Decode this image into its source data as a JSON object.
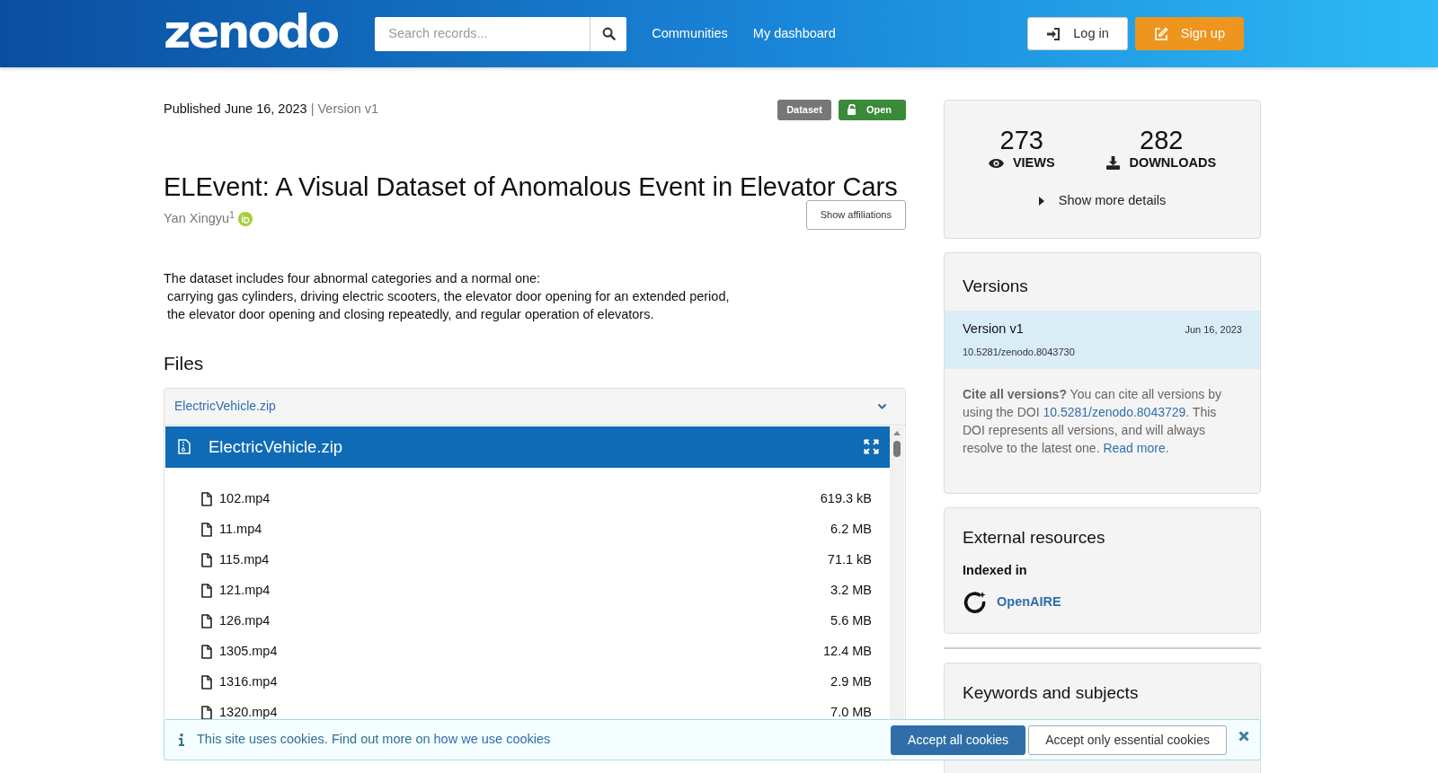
{
  "header": {
    "logo": "zenodo",
    "search": {
      "placeholder": "Search records..."
    },
    "nav_links": [
      "Communities",
      "My dashboard"
    ],
    "buttons": [
      {
        "label": "Log in",
        "kind": "login"
      },
      {
        "label": "Sign up",
        "kind": "signup"
      }
    ]
  },
  "record": {
    "published": "Published June 16, 2023",
    "version": "| Version v1",
    "badges": [
      {
        "label": "Dataset",
        "kind": "type"
      },
      {
        "label": "Open",
        "kind": "access"
      }
    ],
    "title": "ELEvent: A Visual Dataset of Anomalous Event in Elevator Cars",
    "creators": [
      {
        "name": "Yan Xingyu",
        "affiliation_mark": "1",
        "orcid": true
      }
    ],
    "affiliations_button": "Show affiliations",
    "description": [
      "The dataset includes four abnormal categories and a normal one:",
      " carrying gas cylinders, driving electric scooters, the elevator door opening for an extended period,",
      " the elevator door opening and closing repeatedly, and regular operation of elevators."
    ]
  },
  "files": {
    "heading": "Files",
    "accordion_title": "ElectricVehicle.zip",
    "expanded": true,
    "preview_title": "ElectricVehicle.zip",
    "entries": [
      {
        "name": "102.mp4",
        "size": "619.3 kB"
      },
      {
        "name": "11.mp4",
        "size": "6.2 MB"
      },
      {
        "name": "115.mp4",
        "size": "71.1 kB"
      },
      {
        "name": "121.mp4",
        "size": "3.2 MB"
      },
      {
        "name": "126.mp4",
        "size": "5.6 MB"
      },
      {
        "name": "1305.mp4",
        "size": "12.4 MB"
      },
      {
        "name": "1316.mp4",
        "size": "2.9 MB"
      },
      {
        "name": "1320.mp4",
        "size": "7.0 MB"
      }
    ]
  },
  "sidebar": {
    "stats": [
      {
        "value": "273",
        "label": "VIEWS",
        "kind": "views"
      },
      {
        "value": "282",
        "label": "DOWNLOADS",
        "kind": "downloads"
      }
    ],
    "more_details": "Show more details",
    "versions": {
      "heading": "Versions",
      "items": [
        {
          "label": "Version v1",
          "date": "Jun 16, 2023",
          "doi": "10.5281/zenodo.8043730",
          "selected": true
        }
      ],
      "cite": [
        {
          "kind": "text",
          "text": "**Cite all versions?** You can cite all versions by using the DOI "
        },
        {
          "kind": "link",
          "text": "10.5281/zenodo.8043729"
        },
        {
          "kind": "text",
          "text": ". This DOI represents all versions, and will always resolve to the latest one. "
        },
        {
          "kind": "link",
          "text": "Read more"
        },
        {
          "kind": "text",
          "text": "."
        }
      ]
    },
    "external": {
      "heading": "External resources",
      "subheading": "Indexed in",
      "items": [
        "OpenAIRE"
      ]
    },
    "keywords": {
      "heading": "Keywords and subjects"
    }
  },
  "cookie_banner": {
    "text": "This site uses cookies. Find out more on ",
    "link": "how we use cookies",
    "buttons": [
      {
        "label": "Accept all cookies",
        "kind": "primary"
      },
      {
        "label": "Accept only essential cookies",
        "kind": "secondary"
      }
    ]
  }
}
